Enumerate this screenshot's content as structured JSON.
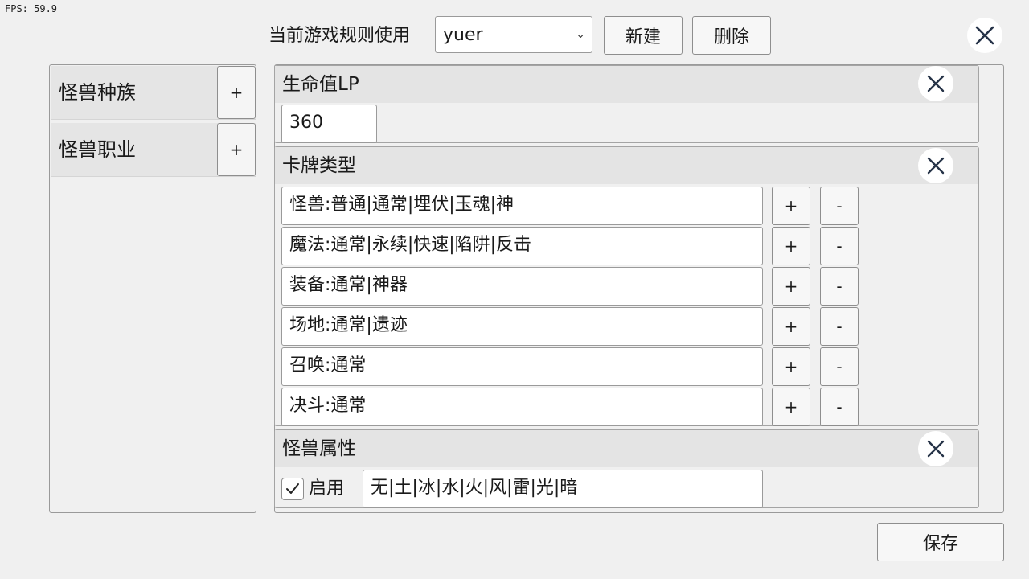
{
  "fps": "FPS:  59.9",
  "header": {
    "rule_label": "当前游戏规则使用",
    "rule_select_value": "yuer",
    "new_label": "新建",
    "delete_label": "删除"
  },
  "sidebar": {
    "items": [
      {
        "label": "怪兽种族",
        "add": "+"
      },
      {
        "label": "怪兽职业",
        "add": "+"
      }
    ]
  },
  "sections": {
    "lp": {
      "title": "生命值LP",
      "value": "360"
    },
    "card_types": {
      "title": "卡牌类型",
      "rows": [
        {
          "value": "怪兽:普通|通常|埋伏|玉魂|神",
          "add": "+",
          "remove": "-"
        },
        {
          "value": "魔法:通常|永续|快速|陷阱|反击",
          "add": "+",
          "remove": "-"
        },
        {
          "value": "装备:通常|神器",
          "add": "+",
          "remove": "-"
        },
        {
          "value": "场地:通常|遗迹",
          "add": "+",
          "remove": "-"
        },
        {
          "value": "召唤:通常",
          "add": "+",
          "remove": "-"
        },
        {
          "value": "决斗:通常",
          "add": "+",
          "remove": "-"
        }
      ]
    },
    "attributes": {
      "title": "怪兽属性",
      "enabled_label": "启用",
      "enabled": true,
      "value": "无|土|冰|水|火|风|雷|光|暗"
    }
  },
  "footer": {
    "save_label": "保存"
  },
  "icons": {
    "close": "close-icon",
    "chevron": "chevron-down-icon",
    "check": "check-icon"
  }
}
